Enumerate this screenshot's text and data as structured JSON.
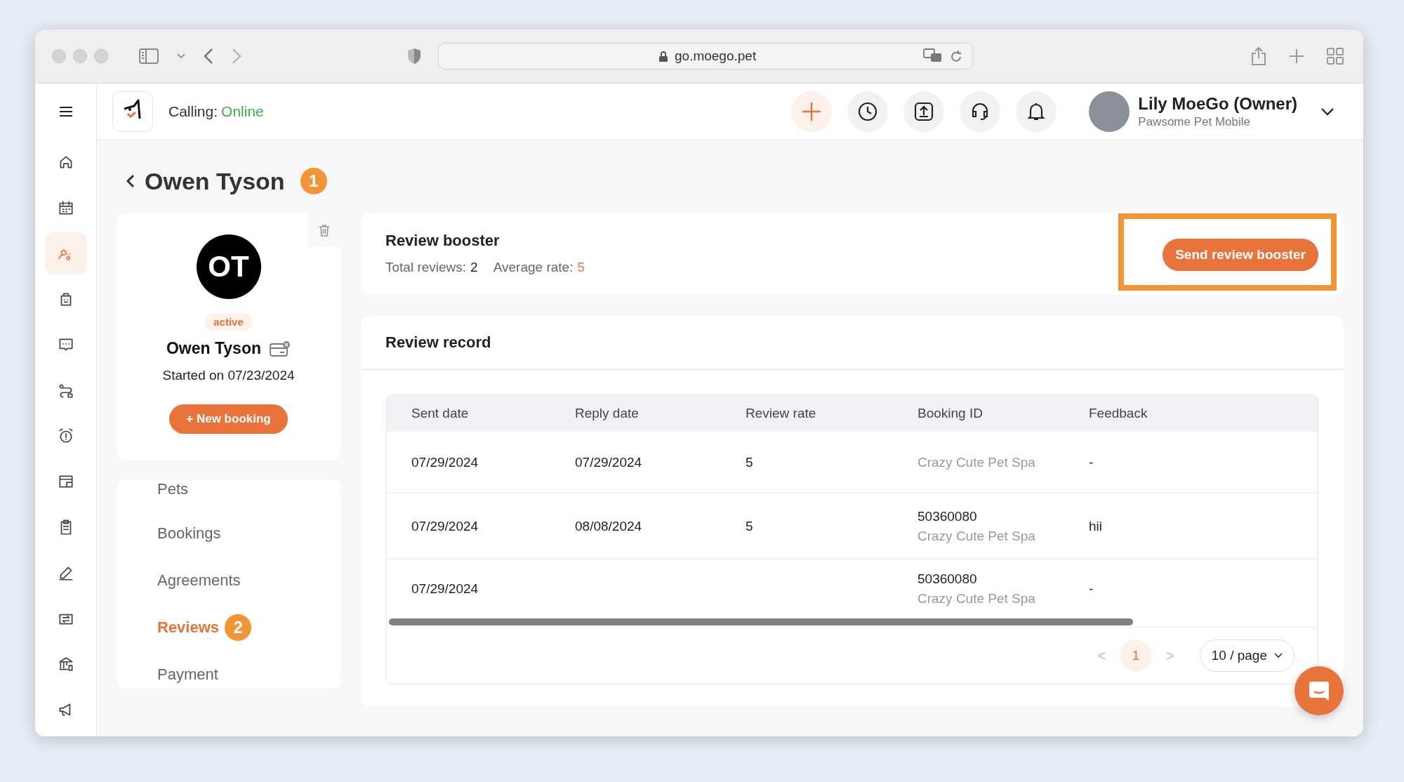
{
  "browser": {
    "url": "go.moego.pet"
  },
  "header": {
    "calling_label": "Calling:",
    "calling_status": "Online",
    "user_name": "Lily MoeGo (Owner)",
    "business": "Pawsome Pet Mobile"
  },
  "sidebar": {
    "items": [
      {
        "selected": false
      },
      {
        "selected": false
      },
      {
        "selected": true
      },
      {
        "selected": false
      },
      {
        "selected": false
      },
      {
        "selected": false
      },
      {
        "selected": false
      },
      {
        "selected": false
      },
      {
        "selected": false
      },
      {
        "selected": false
      },
      {
        "selected": false
      },
      {
        "selected": false
      },
      {
        "selected": false
      }
    ]
  },
  "client": {
    "title": "Owen Tyson",
    "step_badge": "1",
    "initials": "OT",
    "status": "active",
    "name": "Owen Tyson",
    "started": "Started on 07/23/2024",
    "new_booking": "+ New booking"
  },
  "client_nav": [
    {
      "label": "Pets",
      "selected": false
    },
    {
      "label": "Bookings",
      "selected": false
    },
    {
      "label": "Agreements",
      "selected": false
    },
    {
      "label": "Reviews",
      "selected": true,
      "step_badge": "2"
    },
    {
      "label": "Payment",
      "selected": false
    }
  ],
  "review_booster": {
    "title": "Review booster",
    "total_label": "Total reviews:",
    "total": "2",
    "average_label": "Average rate:",
    "average": "5",
    "button": "Send review booster",
    "highlighted": true
  },
  "review_record": {
    "title": "Review record",
    "columns": [
      "Sent date",
      "Reply date",
      "Review rate",
      "Booking ID",
      "Feedback"
    ],
    "rows": [
      {
        "sent_date": "07/29/2024",
        "reply_date": "07/29/2024",
        "review_rate": "5",
        "business": "Crazy Cute Pet Spa",
        "feedback": "-"
      },
      {
        "sent_date": "07/29/2024",
        "reply_date": "08/08/2024",
        "review_rate": "5",
        "booking_id": "50360080",
        "business": "Crazy Cute Pet Spa",
        "feedback": "hii"
      },
      {
        "sent_date": "07/29/2024",
        "booking_id": "50360080",
        "business": "Crazy Cute Pet Spa",
        "feedback": "-"
      }
    ]
  },
  "pagination": {
    "prev": "<",
    "pages": [
      {
        "label": "1",
        "selected": true
      }
    ],
    "next": ">",
    "page_size": "10 / page"
  }
}
